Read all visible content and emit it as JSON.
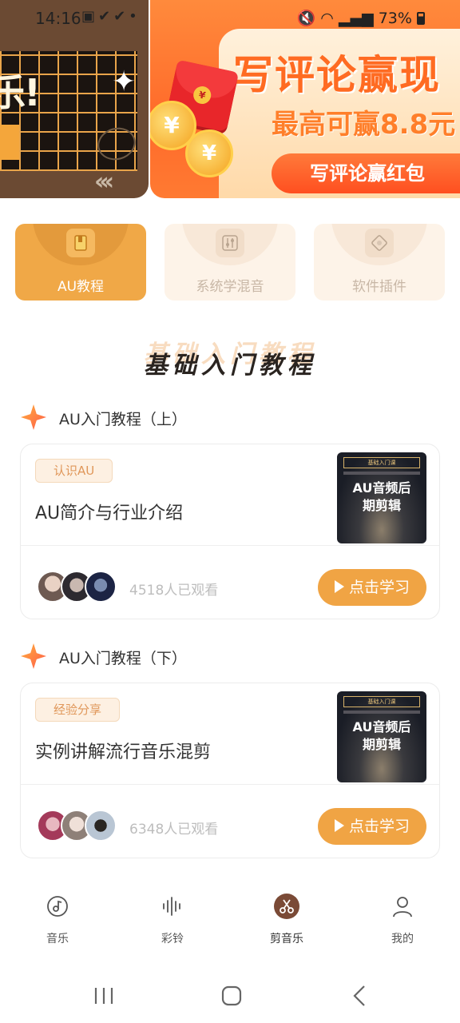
{
  "status_bar": {
    "time": "14:16",
    "battery": "73%"
  },
  "banner": {
    "left_text": "乐!",
    "headline": "写评论赢现",
    "subline": "最高可赢8.8元",
    "cta": "写评论赢红包"
  },
  "categories": [
    {
      "label": "AU教程",
      "icon": "book-icon",
      "active": true
    },
    {
      "label": "系统学混音",
      "icon": "sliders-icon",
      "active": false
    },
    {
      "label": "软件插件",
      "icon": "plugin-icon",
      "active": false
    }
  ],
  "section": {
    "title": "基础入门教程"
  },
  "groups": [
    {
      "title": "AU入门教程（上）",
      "tag": "认识AU",
      "lesson_title": "AU简介与行业介绍",
      "thumb_header": "基础入门课",
      "thumb_line1": "AU音频后",
      "thumb_line2": "期剪辑",
      "views": "4518人已观看",
      "button": "点击学习"
    },
    {
      "title": "AU入门教程（下）",
      "tag": "经验分享",
      "lesson_title": "实例讲解流行音乐混剪",
      "thumb_header": "基础入门课",
      "thumb_line1": "AU音频后",
      "thumb_line2": "期剪辑",
      "views": "6348人已观看",
      "button": "点击学习"
    }
  ],
  "bottom_nav": [
    {
      "label": "音乐",
      "icon": "music-disc-icon"
    },
    {
      "label": "彩铃",
      "icon": "waveform-icon"
    },
    {
      "label": "剪音乐",
      "icon": "scissors-icon",
      "active": true
    },
    {
      "label": "我的",
      "icon": "person-icon"
    }
  ],
  "colors": {
    "accent": "#f0a444",
    "banner_orange": "#ff6a2a",
    "tag_text": "#e0975a"
  }
}
